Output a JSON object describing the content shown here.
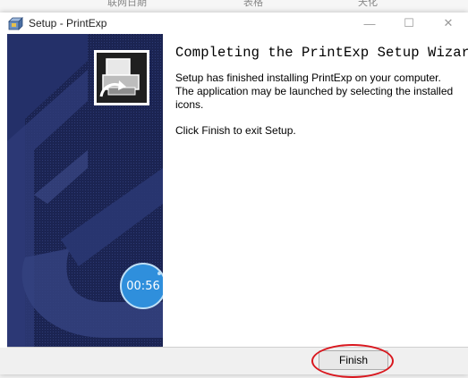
{
  "background_text": [
    "联网日期",
    "表格",
    "天化"
  ],
  "window": {
    "title": "Setup - PrintExp",
    "icon": "setup-box-icon",
    "controls": {
      "minimize": "—",
      "maximize": "☐",
      "close": "✕"
    }
  },
  "side_panel": {
    "image": "wizard-side-graphic",
    "wizard_icon": "printer-install-icon",
    "timer": "00:56"
  },
  "content": {
    "heading": "Completing the PrintExp Setup Wizard",
    "paragraph1": "Setup has finished installing PrintExp on your computer. The application may be launched by selecting the installed icons.",
    "paragraph2": "Click Finish to exit Setup."
  },
  "buttons": {
    "finish": "Finish"
  },
  "colors": {
    "panel_bg": "#1b2452",
    "timer_bg": "#2f8fdc",
    "highlight": "#d9171e"
  }
}
